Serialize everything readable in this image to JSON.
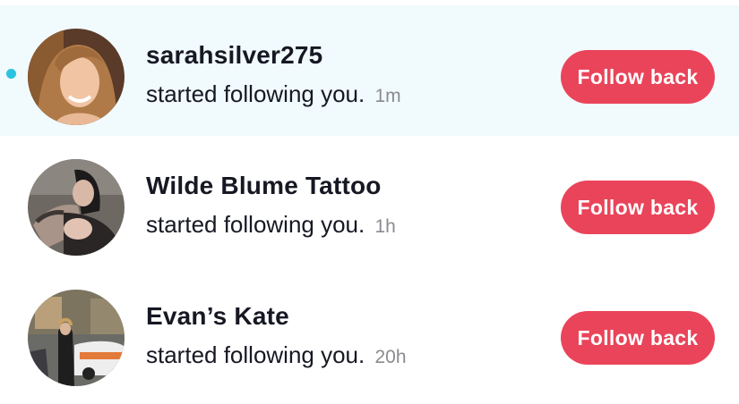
{
  "colors": {
    "accent": "#ea445a",
    "unread_background": "#f1fafd",
    "unread_dot": "#2bc3e0",
    "text_primary": "#161823",
    "text_secondary": "#8a8b91"
  },
  "notifications": [
    {
      "username": "sarahsilver275",
      "message": "started following you.",
      "time": "1m",
      "unread": true,
      "action_label": "Follow back",
      "avatar_icon": "user-avatar-photo"
    },
    {
      "username": "Wilde Blume Tattoo",
      "message": "started following you.",
      "time": "1h",
      "unread": false,
      "action_label": "Follow back",
      "avatar_icon": "user-avatar-photo"
    },
    {
      "username": "Evan’s Kate",
      "message": "started following you.",
      "time": "20h",
      "unread": false,
      "action_label": "Follow back",
      "avatar_icon": "user-avatar-photo"
    }
  ]
}
